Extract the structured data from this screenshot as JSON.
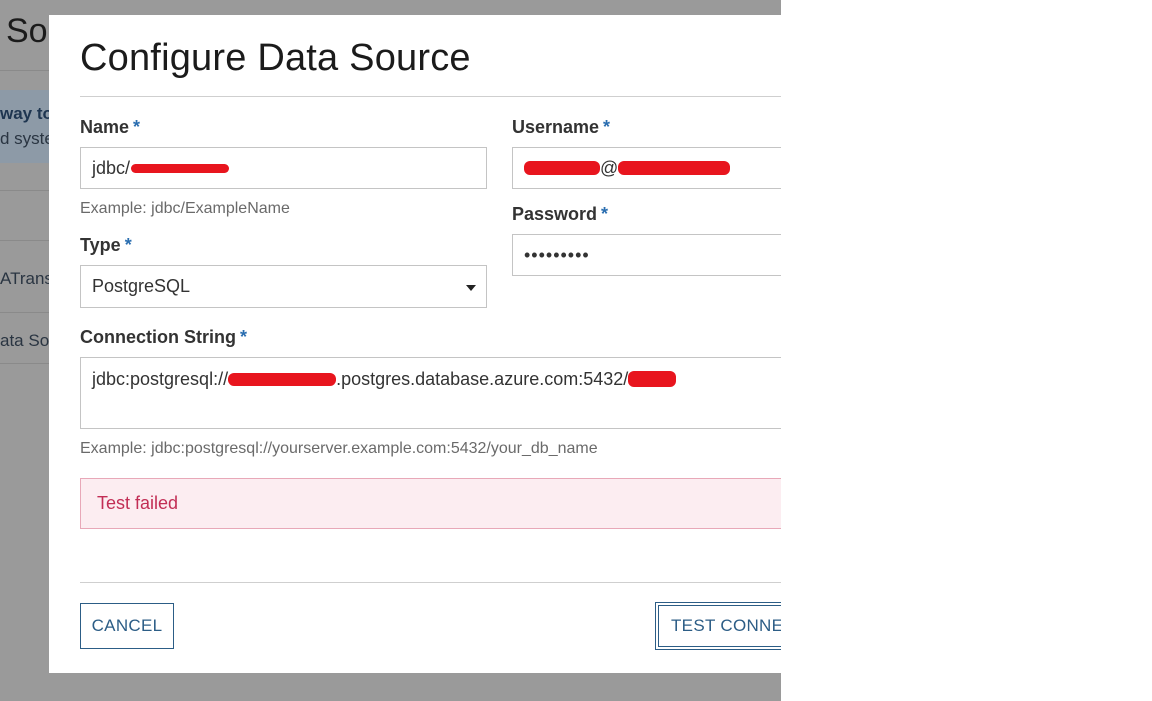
{
  "background_page": {
    "title_fragment": "So",
    "banner_line1": "way to",
    "banner_line2": "d syste",
    "item_1": "ATrans",
    "item_2": "ata So"
  },
  "modal": {
    "title": "Configure Data Source",
    "required_marker": "*",
    "name": {
      "label": "Name",
      "value_prefix": "jdbc/",
      "hint": "Example: jdbc/ExampleName"
    },
    "type": {
      "label": "Type",
      "selected": "PostgreSQL"
    },
    "username": {
      "label": "Username",
      "value_at": "@"
    },
    "password": {
      "label": "Password",
      "value": "•••••••••"
    },
    "connection_string": {
      "label": "Connection String",
      "value_prefix": "jdbc:postgresql://",
      "value_mid": ".postgres.database.azure.com:5432/",
      "hint": "Example: jdbc:postgresql://yourserver.example.com:5432/your_db_name"
    },
    "status": {
      "message": "Test failed"
    },
    "buttons": {
      "cancel": "CANCEL",
      "test_connection": "TEST CONNEC"
    }
  },
  "colors": {
    "accent": "#2c5d86",
    "required_marker": "#2a6eb0",
    "error_bg": "#fcedf1",
    "error_border": "#e8a8b8",
    "error_text": "#c22e55",
    "redaction": "#e8151e",
    "overlay": "#9a9a9a"
  }
}
